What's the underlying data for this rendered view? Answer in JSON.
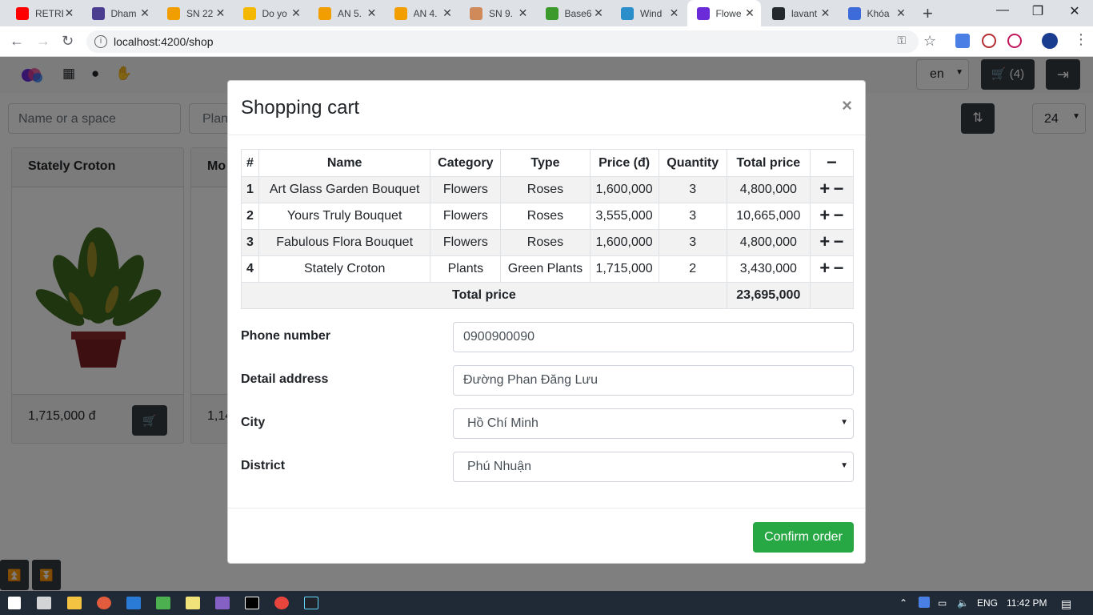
{
  "browser": {
    "tabs": [
      {
        "title": "RETRE",
        "color": "#ff0000"
      },
      {
        "title": "Dham",
        "color": "#4b3d8f"
      },
      {
        "title": "SN 22",
        "color": "#f29d00"
      },
      {
        "title": "Do yo",
        "color": "#f5b800"
      },
      {
        "title": "AN 5.",
        "color": "#f29d00"
      },
      {
        "title": "AN 4.",
        "color": "#f29d00"
      },
      {
        "title": "SN 9.",
        "color": "#d08a5a"
      },
      {
        "title": "Base6",
        "color": "#3c9a2c"
      },
      {
        "title": "Wind",
        "color": "#2a8ecb"
      },
      {
        "title": "Flowe",
        "color": "#6c2bd9"
      },
      {
        "title": "lavant",
        "color": "#24292e"
      },
      {
        "title": "Khóa",
        "color": "#3d6bd9"
      }
    ],
    "url": "localhost:4200/shop"
  },
  "navbar": {
    "lang": "en",
    "cart_label": "(4)"
  },
  "filters": {
    "search_placeholder": "Name or a space",
    "category_placeholder": "Plan",
    "page_size": "24"
  },
  "cards": [
    {
      "name": "Stately Croton",
      "price": "1,715,000 đ"
    },
    {
      "name": "Mo",
      "price": "1,14"
    }
  ],
  "modal": {
    "title": "Shopping cart",
    "close": "×",
    "columns": [
      "#",
      "Name",
      "Category",
      "Type",
      "Price (đ)",
      "Quantity",
      "Total price",
      "−"
    ],
    "rows": [
      {
        "idx": "1",
        "name": "Art Glass Garden Bouquet",
        "category": "Flowers",
        "type": "Roses",
        "price": "1,600,000",
        "qty": "3",
        "total": "4,800,000"
      },
      {
        "idx": "2",
        "name": "Yours Truly Bouquet",
        "category": "Flowers",
        "type": "Roses",
        "price": "3,555,000",
        "qty": "3",
        "total": "10,665,000"
      },
      {
        "idx": "3",
        "name": "Fabulous Flora Bouquet",
        "category": "Flowers",
        "type": "Roses",
        "price": "1,600,000",
        "qty": "3",
        "total": "4,800,000"
      },
      {
        "idx": "4",
        "name": "Stately Croton",
        "category": "Plants",
        "type": "Green Plants",
        "price": "1,715,000",
        "qty": "2",
        "total": "3,430,000"
      }
    ],
    "total_label": "Total price",
    "total_value": "23,695,000",
    "form": {
      "phone_label": "Phone number",
      "phone_value": "0900900090",
      "address_label": "Detail address",
      "address_value": "Đường Phan Đăng Lưu",
      "city_label": "City",
      "city_value": "Hồ Chí Minh",
      "district_label": "District",
      "district_value": "Phú Nhuận"
    },
    "confirm_label": "Confirm order"
  },
  "taskbar": {
    "lang": "ENG",
    "time": "11:42 PM"
  },
  "colors": {
    "confirm": "#28a745",
    "dark_button": "#343a40",
    "taskbar": "#1f2a36"
  }
}
